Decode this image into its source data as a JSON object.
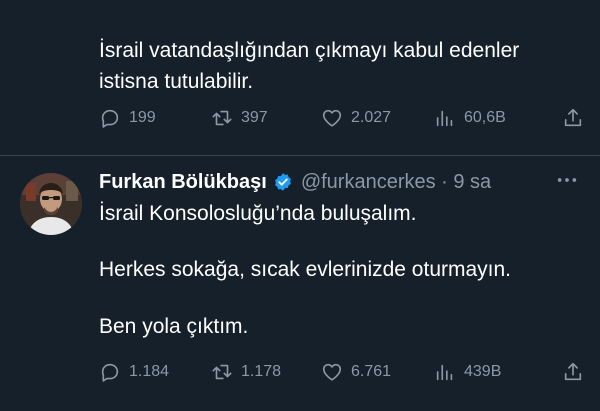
{
  "tweets": [
    {
      "text_lines": [
        "İsrail vatandaşlığından çıkmayı kabul edenler",
        "istisna tutulabilir."
      ],
      "stats": {
        "replies": "199",
        "retweets": "397",
        "likes": "2.027",
        "views": "60,6B"
      }
    },
    {
      "author": {
        "name": "Furkan Bölükbaşı",
        "handle_time": "@furkancerkes · 9 sa"
      },
      "text_lines": [
        "İsrail Konsolosluğu’nda buluşalım.",
        "Herkes sokağa, sıcak evlerinizde oturmayın.",
        "Ben yola çıktım."
      ],
      "stats": {
        "replies": "1.184",
        "retweets": "1.178",
        "likes": "6.761",
        "views": "439B"
      }
    }
  ],
  "icons": {
    "reply": "reply-icon",
    "retweet": "retweet-icon",
    "like": "heart-icon",
    "views": "views-icon",
    "share": "share-icon",
    "verified": "verified-badge-icon",
    "more": "more-dots-icon"
  },
  "colors": {
    "background": "#15202b",
    "text": "#ffffff",
    "secondary": "#8b98a5",
    "verified": "#1d9bf0",
    "divider": "#38444d"
  }
}
